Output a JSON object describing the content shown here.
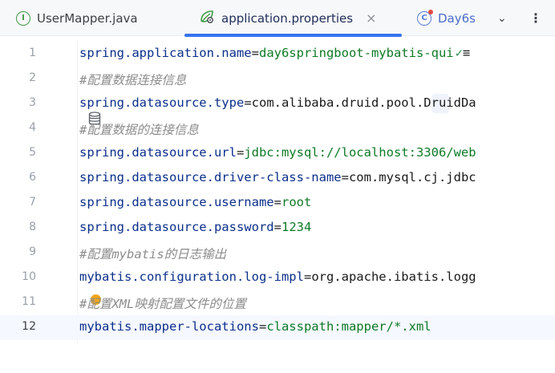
{
  "tabs": [
    {
      "label": "UserMapper.java",
      "icon": "interface-icon",
      "icon_letter": "I"
    },
    {
      "label": "application.properties",
      "icon": "spring-leaf-icon",
      "active": true
    },
    {
      "label": "Day6s",
      "icon": "class-icon",
      "icon_letter": "C"
    }
  ],
  "tab_actions": {
    "chevron": "⌄",
    "more": "⋮",
    "close": "×"
  },
  "lines": [
    {
      "n": "1",
      "key": "spring.application.name",
      "value": "day6springboot-mybatis-qui",
      "check": "✓",
      "more": "≡"
    },
    {
      "n": "2",
      "comment": "#配置数据连接信息"
    },
    {
      "n": "3",
      "key": "spring.datasource.type",
      "value": "com.alibaba.druid.pool.DruidDa"
    },
    {
      "n": "4",
      "comment": "#配置数据的连接信息"
    },
    {
      "n": "5",
      "key": "spring.datasource.url",
      "value": "jdbc:mysql://localhost:3306/web"
    },
    {
      "n": "6",
      "key": "spring.datasource.driver-class-name",
      "value": "com.mysql.cj.jdbc"
    },
    {
      "n": "7",
      "key": "spring.datasource.username",
      "value": "root"
    },
    {
      "n": "8",
      "key": "spring.datasource.password",
      "value": "1234"
    },
    {
      "n": "9",
      "comment": "#配置mybatis的日志输出"
    },
    {
      "n": "10",
      "key": "mybatis.configuration.log-impl",
      "value": "org.apache.ibatis.logg"
    },
    {
      "n": "11",
      "comment": "#配置XML映射配置文件的位置"
    },
    {
      "n": "12",
      "key": "mybatis.mapper-locations",
      "value": "classpath:mapper/*.xml",
      "current": true
    }
  ],
  "colors": {
    "accent": "#3574f0",
    "key": "#0b2f8a",
    "value": "#0f7a26",
    "comment": "#8c8c8c"
  }
}
